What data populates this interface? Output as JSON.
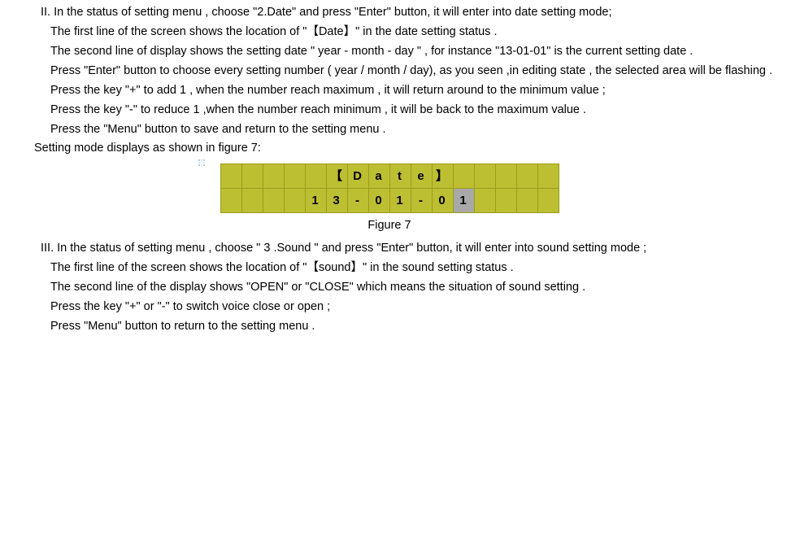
{
  "section2": {
    "p1": "II. In the status of setting menu , choose \"2.Date\" and press \"Enter\" button, it will enter into date setting mode;",
    "p2": "The first line of the screen shows the location of \"【Date】\" in the date setting status .",
    "p3": "The second line of display shows the setting date \" year - month - day \" , for instance \"13-01-01\" is the current setting date .",
    "p4": "Press \"Enter\" button to choose every setting number ( year / month / day), as you seen ,in editing state , the selected area will be flashing .",
    "p5": "Press the key   \"+\" to add 1 , when the number reach maximum , it will return around to the minimum value ;",
    "p6": "Press the key \"-\" to reduce 1 ,when the number reach minimum , it will be back to the maximum value .",
    "p7": "Press the \"Menu\" button to save and return to the setting menu .",
    "p8": "Setting mode displays as shown in figure 7:"
  },
  "figure": {
    "caption": "Figure 7",
    "row1": [
      "",
      "",
      "",
      "",
      "",
      "【",
      "D",
      "a",
      "t",
      "e",
      "】",
      "",
      "",
      "",
      "",
      ""
    ],
    "row2": [
      "",
      "",
      "",
      "",
      "1",
      "3",
      "-",
      "0",
      "1",
      "-",
      "0",
      "1",
      "",
      "",
      "",
      ""
    ],
    "row2_cursor_index": 11
  },
  "section3": {
    "p1": "III. In the status of setting menu , choose \" 3 .Sound \" and press \"Enter\" button, it will enter into sound setting mode ;",
    "p2": "The first line of the screen shows the location of \"【sound】\" in the sound setting status .",
    "p3": "The second line of the display shows \"OPEN\" or \"CLOSE\" which means the situation of sound setting .",
    "p4": "Press the key \"+\" or \"-\" to switch voice close or open ;",
    "p5": "Press \"Menu\" button to return to the setting menu ."
  }
}
